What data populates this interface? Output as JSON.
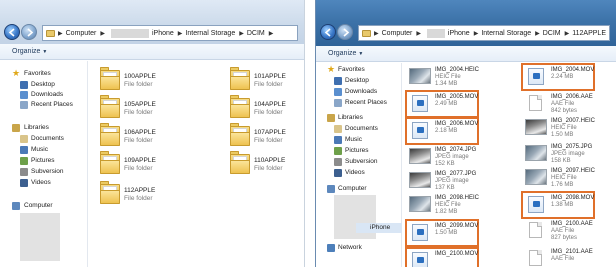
{
  "left_window": {
    "address": {
      "crumbs": [
        "Computer",
        "iPhone",
        "Internal Storage",
        "DCIM"
      ]
    },
    "toolbar": {
      "organize_label": "Organize"
    },
    "nav": {
      "favorites_label": "Favorites",
      "favorites": [
        "Desktop",
        "Downloads",
        "Recent Places"
      ],
      "libraries_label": "Libraries",
      "libraries": [
        "Documents",
        "Music",
        "Pictures",
        "Subversion",
        "Videos"
      ],
      "computer_label": "Computer"
    },
    "folders": [
      {
        "name": "100APPLE",
        "type": "File folder"
      },
      {
        "name": "101APPLE",
        "type": "File folder"
      },
      {
        "name": "105APPLE",
        "type": "File folder"
      },
      {
        "name": "104APPLE",
        "type": "File folder"
      },
      {
        "name": "106APPLE",
        "type": "File folder"
      },
      {
        "name": "107APPLE",
        "type": "File folder"
      },
      {
        "name": "109APPLE",
        "type": "File folder"
      },
      {
        "name": "110APPLE",
        "type": "File folder"
      },
      {
        "name": "112APPLE",
        "type": "File folder"
      }
    ]
  },
  "right_window": {
    "address": {
      "crumbs": [
        "Computer",
        "iPhone",
        "Internal Storage",
        "DCIM",
        "112APPLE"
      ]
    },
    "toolbar": {
      "organize_label": "Organize"
    },
    "nav": {
      "favorites_label": "Favorites",
      "favorites": [
        "Desktop",
        "Downloads",
        "Recent Places"
      ],
      "libraries_label": "Libraries",
      "libraries": [
        "Documents",
        "Music",
        "Pictures",
        "Subversion",
        "Videos"
      ],
      "computer_label": "Computer",
      "iphone_label": "iPhone",
      "network_label": "Network"
    },
    "files": [
      {
        "name": "IMG_2004.HEIC",
        "type": "HEIC File",
        "size": "1.34 MB",
        "icon": "photo-thumbnail",
        "highlighted": false
      },
      {
        "name": "IMG_2004.MOV",
        "type": "",
        "size": "2.24 MB",
        "icon": "movie-file-icon",
        "highlighted": true
      },
      {
        "name": "IMG_2005.MOV",
        "type": "",
        "size": "2.49 MB",
        "icon": "movie-file-icon",
        "highlighted": true
      },
      {
        "name": "IMG_2006.AAE",
        "type": "AAE File",
        "size": "842 bytes",
        "icon": "document-icon",
        "highlighted": false
      },
      {
        "name": "IMG_2006.MOV",
        "type": "",
        "size": "2.18 MB",
        "icon": "movie-file-icon",
        "highlighted": true
      },
      {
        "name": "IMG_2007.HEIC",
        "type": "HEIC File",
        "size": "1.50 MB",
        "icon": "photo-thumbnail",
        "highlighted": false
      },
      {
        "name": "IMG_2074.JPG",
        "type": "JPEG image",
        "size": "152 KB",
        "icon": "photo-thumbnail",
        "highlighted": false
      },
      {
        "name": "IMG_2075.JPG",
        "type": "JPEG image",
        "size": "158 KB",
        "icon": "photo-thumbnail",
        "highlighted": false
      },
      {
        "name": "IMG_2077.JPG",
        "type": "JPEG image",
        "size": "137 KB",
        "icon": "photo-thumbnail",
        "highlighted": false
      },
      {
        "name": "IMG_2097.HEIC",
        "type": "HEIC File",
        "size": "1.76 MB",
        "icon": "photo-thumbnail",
        "highlighted": false
      },
      {
        "name": "IMG_2098.HEIC",
        "type": "HEIC File",
        "size": "1.82 MB",
        "icon": "photo-thumbnail",
        "highlighted": false
      },
      {
        "name": "IMG_2098.MOV",
        "type": "",
        "size": "1.38 MB",
        "icon": "movie-file-icon",
        "highlighted": true
      },
      {
        "name": "IMG_2099.MOV",
        "type": "",
        "size": "1.50 MB",
        "icon": "movie-file-icon",
        "highlighted": true
      },
      {
        "name": "IMG_2100.AAE",
        "type": "AAE File",
        "size": "827 bytes",
        "icon": "document-icon",
        "highlighted": false
      },
      {
        "name": "IMG_2100.MOV",
        "type": "",
        "size": "",
        "icon": "movie-file-icon",
        "highlighted": true
      },
      {
        "name": "IMG_2101.AAE",
        "type": "AAE File",
        "size": "",
        "icon": "document-icon",
        "highlighted": false
      }
    ]
  },
  "colors": {
    "highlight": "#e0702a",
    "folder": "#eec250",
    "chrome_active": "#3d73a9"
  }
}
